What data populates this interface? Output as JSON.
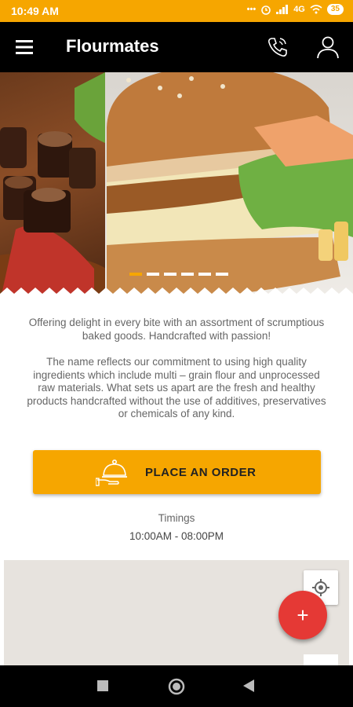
{
  "status_bar": {
    "time": "10:49 AM",
    "network_label": "4G",
    "battery_label": "35",
    "icons": [
      "dots-icon",
      "alarm-icon",
      "signal-icon",
      "wifi-icon",
      "battery-icon"
    ]
  },
  "app_bar": {
    "title": "Flourmates",
    "icons": [
      "menu-icon",
      "phone-icon",
      "user-icon"
    ]
  },
  "carousel": {
    "slide_count": 6,
    "active_index": 0
  },
  "content": {
    "description_1": "Offering delight in every bite with an assortment of scrumptious baked goods. Handcrafted with passion!",
    "description_2": "The name reflects our commitment to using high quality ingredients which include multi – grain flour and unprocessed raw materials. What sets us apart are the fresh and healthy products handcrafted without the use of additives, preservatives or chemicals of any kind."
  },
  "order_button": {
    "label": "PLACE AN ORDER",
    "icon": "serving-tray-icon"
  },
  "timings": {
    "label": "Timings",
    "value": "10:00AM - 08:00PM"
  },
  "fab": {
    "icon": "plus-icon",
    "label": "+"
  },
  "nav_bar": {
    "icons": [
      "recent-apps-icon",
      "home-icon",
      "back-icon"
    ]
  },
  "colors": {
    "accent": "#f6a600",
    "app_bar": "#000000",
    "fab": "#e53935",
    "text_secondary": "#666666"
  }
}
